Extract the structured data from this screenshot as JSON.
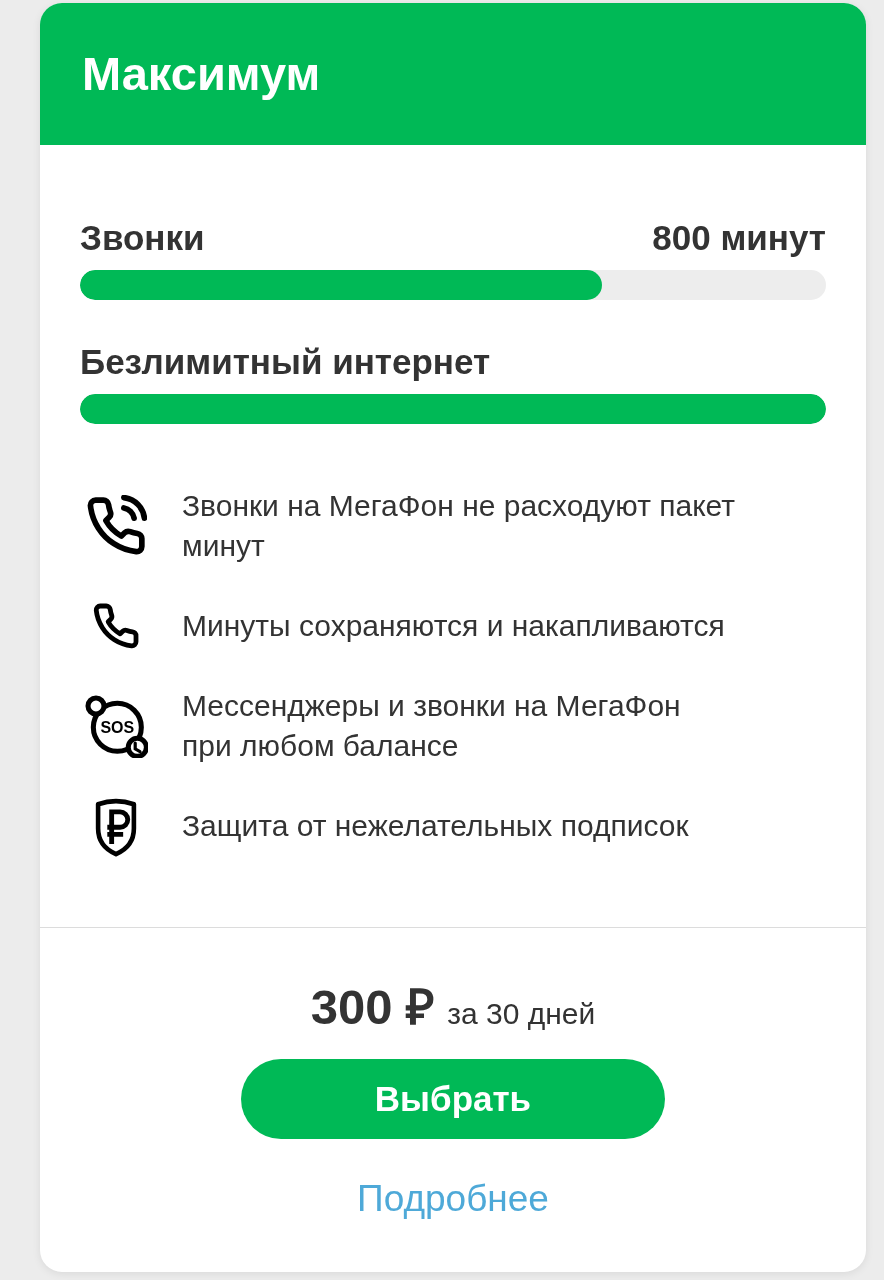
{
  "header": {
    "title": "Максимум"
  },
  "allowances": [
    {
      "label": "Звонки",
      "amount": "800 минут",
      "level": 0.7
    },
    {
      "label": "Безлимитный интернет",
      "level": 1
    }
  ],
  "features": [
    {
      "kind": "calls",
      "text": "Звонки на МегаФон не расходуют пакет минут"
    },
    {
      "kind": "phone",
      "text": "Минуты сохраняются и накапливаются"
    },
    {
      "kind": "sos",
      "icon_text": "SOS",
      "text": "Мессенджеры и звонки на МегаФон\nпри любом балансе"
    },
    {
      "kind": "shield",
      "text": "Защита от нежелательных подписок"
    }
  ],
  "price": {
    "amount": "300 ₽",
    "period": "за 30 дней"
  },
  "select_button": {
    "label": "Выбрать"
  },
  "details_link": {
    "label": "Подробнее"
  }
}
